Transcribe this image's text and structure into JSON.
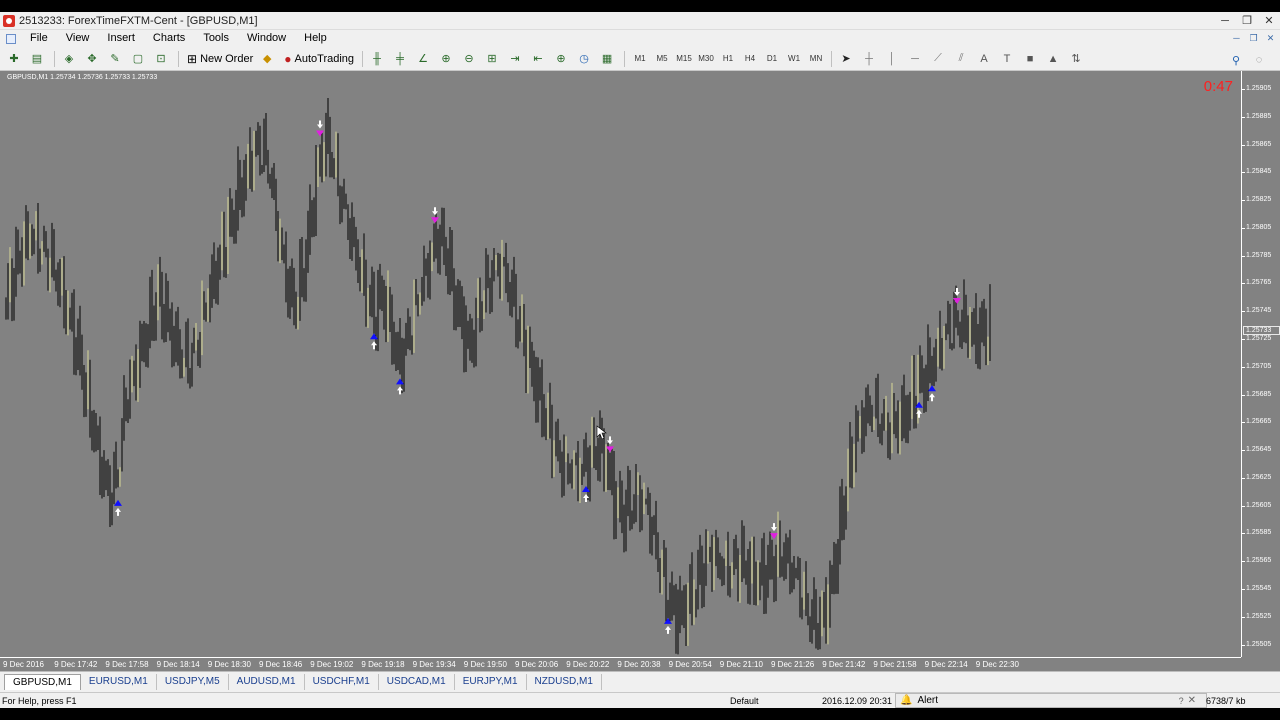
{
  "window": {
    "title": "2513233: ForexTimeFXTM-Cent - [GBPUSD,M1]",
    "buttons": [
      "─",
      "❐",
      "✕"
    ]
  },
  "menu": {
    "items": [
      "File",
      "View",
      "Insert",
      "Charts",
      "Tools",
      "Window",
      "Help"
    ],
    "mdi_buttons": [
      "─",
      "❐",
      "✕"
    ]
  },
  "toolbar": {
    "new_order_label": "New Order",
    "autotrading_label": "AutoTrading",
    "timeframes": [
      "M1",
      "M5",
      "M15",
      "M30",
      "H1",
      "H4",
      "D1",
      "W1",
      "MN"
    ]
  },
  "chart": {
    "info": "GBPUSD,M1  1.25734 1.25736 1.25733 1.25733",
    "timer": "0:47",
    "current_price": "1.25733",
    "colors": {
      "background": "#828282",
      "candle": "#000000",
      "bull_candle": "#d8d896",
      "buy_arrow": "#1010ff",
      "sell_arrow": "#e020e0",
      "signal_mark": "#ffffff",
      "timer": "#ff2020"
    }
  },
  "chart_data": {
    "type": "candlestick",
    "symbol": "GBPUSD",
    "timeframe": "M1",
    "ylim": [
      1.25496,
      1.25918
    ],
    "yticks": [
      "1.25905",
      "1.25885",
      "1.25865",
      "1.25845",
      "1.25825",
      "1.25805",
      "1.25785",
      "1.25765",
      "1.25745",
      "1.25725",
      "1.25705",
      "1.25685",
      "1.25665",
      "1.25645",
      "1.25625",
      "1.25605",
      "1.25585",
      "1.25565",
      "1.25545",
      "1.25525",
      "1.25505"
    ],
    "xticks": [
      "9 Dec 2016",
      "9 Dec 17:42",
      "9 Dec 17:58",
      "9 Dec 18:14",
      "9 Dec 18:30",
      "9 Dec 18:46",
      "9 Dec 19:02",
      "9 Dec 19:18",
      "9 Dec 19:34",
      "9 Dec 19:50",
      "9 Dec 20:06",
      "9 Dec 20:22",
      "9 Dec 20:38",
      "9 Dec 20:54",
      "9 Dec 21:10",
      "9 Dec 21:26",
      "9 Dec 21:42",
      "9 Dec 21:58",
      "9 Dec 22:14",
      "9 Dec 22:30"
    ],
    "series": [
      {
        "x": [
          0,
          8,
          16,
          24,
          32,
          40,
          48,
          56,
          64,
          72,
          80,
          88,
          96,
          104,
          112,
          120,
          128,
          136,
          144,
          152,
          160,
          168,
          176,
          184,
          192,
          200,
          208,
          216,
          224,
          232,
          240,
          248,
          256,
          264,
          272,
          280,
          288,
          296,
          304,
          312,
          320,
          328,
          336,
          344,
          352,
          360,
          368,
          376,
          384,
          392,
          400,
          408,
          416,
          424,
          432,
          440,
          448,
          456,
          464,
          472,
          480,
          488,
          496,
          504,
          512,
          520,
          528,
          536,
          544,
          552,
          560,
          568,
          576,
          584,
          592,
          600,
          608,
          616,
          624,
          632,
          640,
          648,
          656,
          664,
          672,
          680,
          688,
          696,
          704,
          712,
          720,
          728,
          736,
          744,
          752,
          760,
          768,
          776,
          784,
          792,
          800,
          808,
          816,
          824,
          832,
          840,
          848,
          856,
          864,
          872,
          880,
          888,
          896,
          904,
          912,
          920,
          928,
          936,
          944,
          952,
          960,
          968,
          976,
          984
        ],
        "values": [
          1.25755,
          1.25775,
          1.2579,
          1.258,
          1.2579,
          1.2578,
          1.25775,
          1.2576,
          1.2574,
          1.2572,
          1.2569,
          1.2566,
          1.2563,
          1.2561,
          1.25625,
          1.2568,
          1.257,
          1.2572,
          1.2574,
          1.2576,
          1.25745,
          1.25725,
          1.2571,
          1.25705,
          1.2572,
          1.2575,
          1.2577,
          1.2579,
          1.2581,
          1.2583,
          1.25845,
          1.2586,
          1.2586,
          1.2584,
          1.258,
          1.2577,
          1.2575,
          1.2577,
          1.2581,
          1.2585,
          1.2587,
          1.2585,
          1.2582,
          1.258,
          1.2578,
          1.2576,
          1.25745,
          1.2576,
          1.2574,
          1.2571,
          1.2572,
          1.2574,
          1.2576,
          1.2578,
          1.258,
          1.2579,
          1.2576,
          1.2574,
          1.2572,
          1.25745,
          1.2576,
          1.2577,
          1.25775,
          1.2576,
          1.2574,
          1.2572,
          1.257,
          1.2568,
          1.2566,
          1.2564,
          1.2563,
          1.25625,
          1.2563,
          1.2564,
          1.2565,
          1.2564,
          1.25615,
          1.256,
          1.25605,
          1.2561,
          1.256,
          1.2558,
          1.25555,
          1.25535,
          1.2553,
          1.25535,
          1.25545,
          1.2556,
          1.2557,
          1.2556,
          1.25555,
          1.2556,
          1.25565,
          1.2556,
          1.25555,
          1.2556,
          1.25565,
          1.2557,
          1.2556,
          1.25545,
          1.2553,
          1.2552,
          1.25525,
          1.25545,
          1.2558,
          1.2562,
          1.2565,
          1.25665,
          1.2567,
          1.25665,
          1.2566,
          1.25665,
          1.2567,
          1.2568,
          1.25695,
          1.257,
          1.2571,
          1.2572,
          1.2573,
          1.25735,
          1.25735,
          1.2573,
          1.25733,
          1.25733
        ]
      }
    ],
    "buy_signal_x": [
      112,
      368,
      394,
      580,
      662,
      913,
      926
    ],
    "sell_signal_x": [
      314,
      429,
      604,
      768,
      951
    ]
  },
  "tabs": [
    "GBPUSD,M1",
    "EURUSD,M1",
    "USDJPY,M5",
    "AUDUSD,M1",
    "USDCHF,M1",
    "USDCAD,M1",
    "EURJPY,M1",
    "NZDUSD,M1"
  ],
  "status": {
    "help": "For Help, press F1",
    "profile": "Default",
    "datetime": "2016.12.09 20:31",
    "alert_label": "Alert",
    "memory": "6738/7 kb"
  }
}
